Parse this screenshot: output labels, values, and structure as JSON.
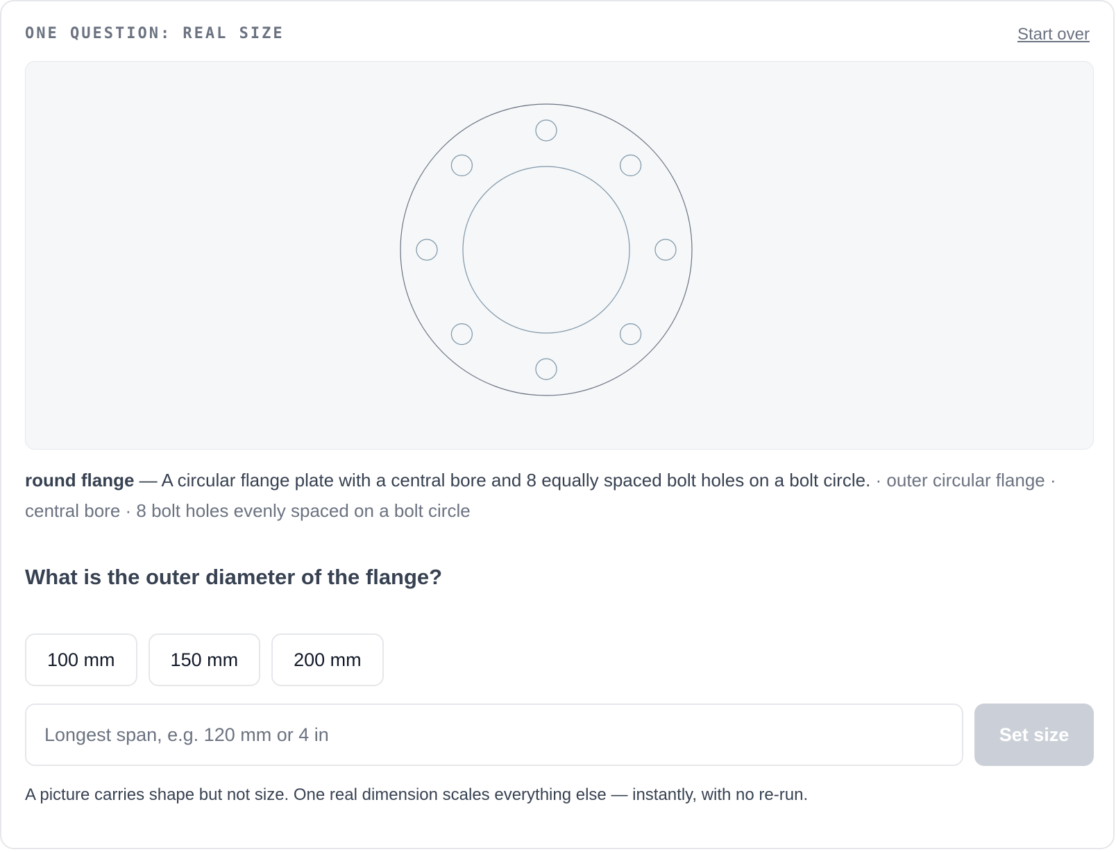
{
  "header": {
    "eyebrow": "ONE QUESTION: REAL SIZE",
    "start_over_label": "Start over"
  },
  "preview": {
    "bolt_hole_count": 8,
    "outline_color": "#6b7280",
    "feature_color": "#7d95a6"
  },
  "description": {
    "object_name": "round flange",
    "separator": " — ",
    "summary": "A circular flange plate with a central bore and 8 equally spaced bolt holes on a bolt circle.",
    "parts": "· outer circular flange · central bore · 8 bolt holes evenly spaced on a bolt circle"
  },
  "question": {
    "text": "What is the outer diameter of the flange?"
  },
  "options": [
    {
      "label": "100 mm"
    },
    {
      "label": "150 mm"
    },
    {
      "label": "200 mm"
    }
  ],
  "size_input": {
    "value": "",
    "placeholder": "Longest span, e.g. 120 mm or 4 in"
  },
  "set_size_label": "Set size",
  "footnote": "A picture carries shape but not size. One real dimension scales everything else — instantly, with no re-run."
}
